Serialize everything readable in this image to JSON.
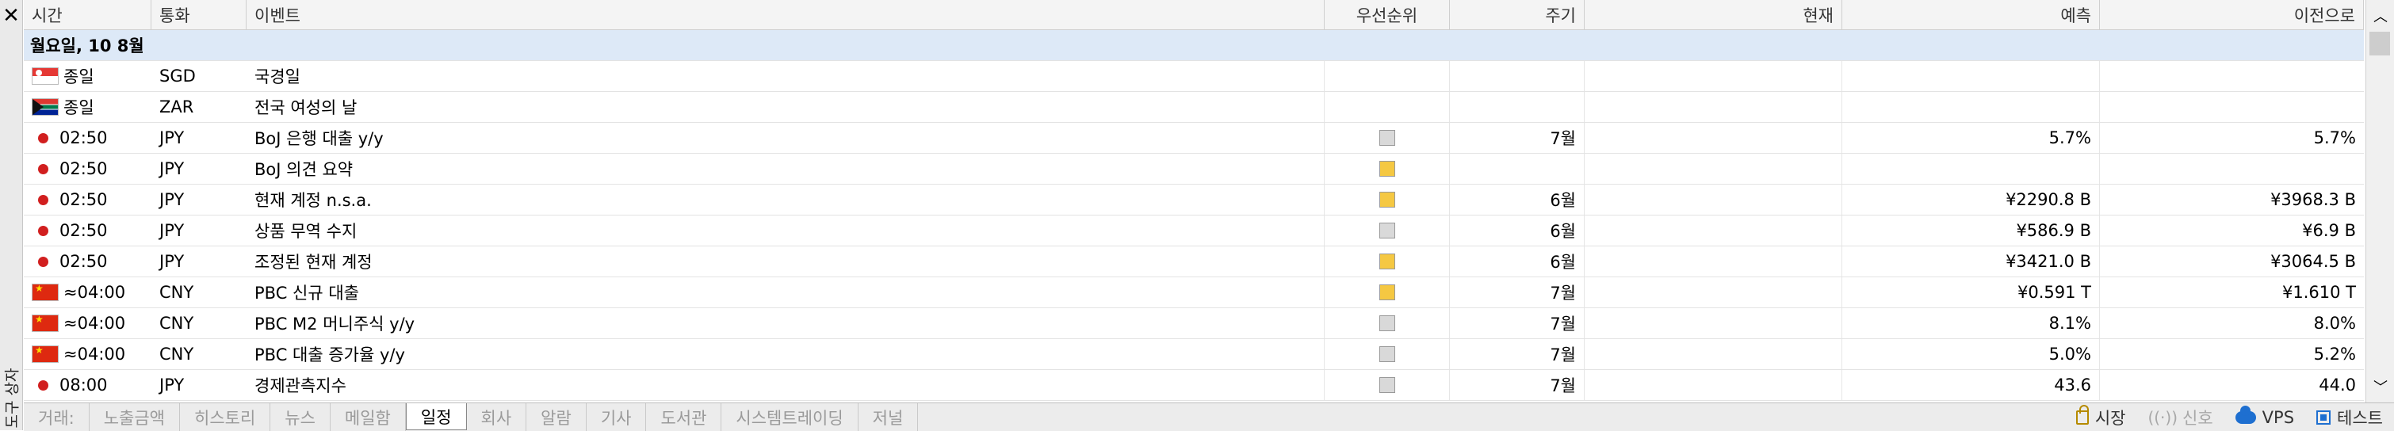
{
  "toolbox": {
    "close_glyph": "✕",
    "title": "도구 상자"
  },
  "columns": {
    "time": "시간",
    "currency": "통화",
    "event": "이벤트",
    "priority": "우선순위",
    "period": "주기",
    "actual": "현재",
    "forecast": "예측",
    "previous": "이전으로"
  },
  "group_label": "월요일, 10 8월",
  "colors": {
    "priority_high": "#f5c842",
    "priority_low": "#d9d9d9",
    "event_dot": "#d11f1f",
    "group_bg": "#dde9f7"
  },
  "rows": [
    {
      "icon": "flag-sg",
      "time": "종일",
      "currency": "SGD",
      "event": "국경일",
      "priority": "",
      "period": "",
      "actual": "",
      "forecast": "",
      "previous": ""
    },
    {
      "icon": "flag-za",
      "time": "종일",
      "currency": "ZAR",
      "event": "전국 여성의 날",
      "priority": "",
      "period": "",
      "actual": "",
      "forecast": "",
      "previous": ""
    },
    {
      "icon": "dot",
      "time": "02:50",
      "currency": "JPY",
      "event": "BoJ 은행 대출 y/y",
      "priority": "low",
      "period": "7월",
      "actual": "",
      "forecast": "5.7%",
      "previous": "5.7%"
    },
    {
      "icon": "dot",
      "time": "02:50",
      "currency": "JPY",
      "event": "BoJ 의견 요약",
      "priority": "high",
      "period": "",
      "actual": "",
      "forecast": "",
      "previous": ""
    },
    {
      "icon": "dot",
      "time": "02:50",
      "currency": "JPY",
      "event": "현재 계정 n.s.a.",
      "priority": "high",
      "period": "6월",
      "actual": "",
      "forecast": "¥2290.8 B",
      "previous": "¥3968.3 B"
    },
    {
      "icon": "dot",
      "time": "02:50",
      "currency": "JPY",
      "event": "상품 무역 수지",
      "priority": "low",
      "period": "6월",
      "actual": "",
      "forecast": "¥586.9 B",
      "previous": "¥6.9 B"
    },
    {
      "icon": "dot",
      "time": "02:50",
      "currency": "JPY",
      "event": "조정된 현재 계정",
      "priority": "high",
      "period": "6월",
      "actual": "",
      "forecast": "¥3421.0 B",
      "previous": "¥3064.5 B"
    },
    {
      "icon": "flag-cn",
      "time": "≈04:00",
      "currency": "CNY",
      "event": "PBC 신규 대출",
      "priority": "high",
      "period": "7월",
      "actual": "",
      "forecast": "¥0.591 T",
      "previous": "¥1.610 T"
    },
    {
      "icon": "flag-cn",
      "time": "≈04:00",
      "currency": "CNY",
      "event": "PBC M2 머니주식 y/y",
      "priority": "low",
      "period": "7월",
      "actual": "",
      "forecast": "8.1%",
      "previous": "8.0%"
    },
    {
      "icon": "flag-cn",
      "time": "≈04:00",
      "currency": "CNY",
      "event": "PBC 대출 증가율 y/y",
      "priority": "low",
      "period": "7월",
      "actual": "",
      "forecast": "5.0%",
      "previous": "5.2%"
    },
    {
      "icon": "dot",
      "time": "08:00",
      "currency": "JPY",
      "event": "경제관측지수",
      "priority": "low",
      "period": "7월",
      "actual": "",
      "forecast": "43.6",
      "previous": "44.0"
    }
  ],
  "tabs": [
    {
      "label": "거래:",
      "active": false
    },
    {
      "label": "노출금액",
      "active": false
    },
    {
      "label": "히스토리",
      "active": false
    },
    {
      "label": "뉴스",
      "active": false
    },
    {
      "label": "메일함",
      "active": false
    },
    {
      "label": "일정",
      "active": true
    },
    {
      "label": "회사",
      "active": false
    },
    {
      "label": "알람",
      "active": false
    },
    {
      "label": "기사",
      "active": false
    },
    {
      "label": "도서관",
      "active": false
    },
    {
      "label": "시스템트레이딩",
      "active": false
    },
    {
      "label": "저널",
      "active": false
    }
  ],
  "status": {
    "market": "시장",
    "signal": "신호",
    "vps": "VPS",
    "tester": "테스트"
  }
}
